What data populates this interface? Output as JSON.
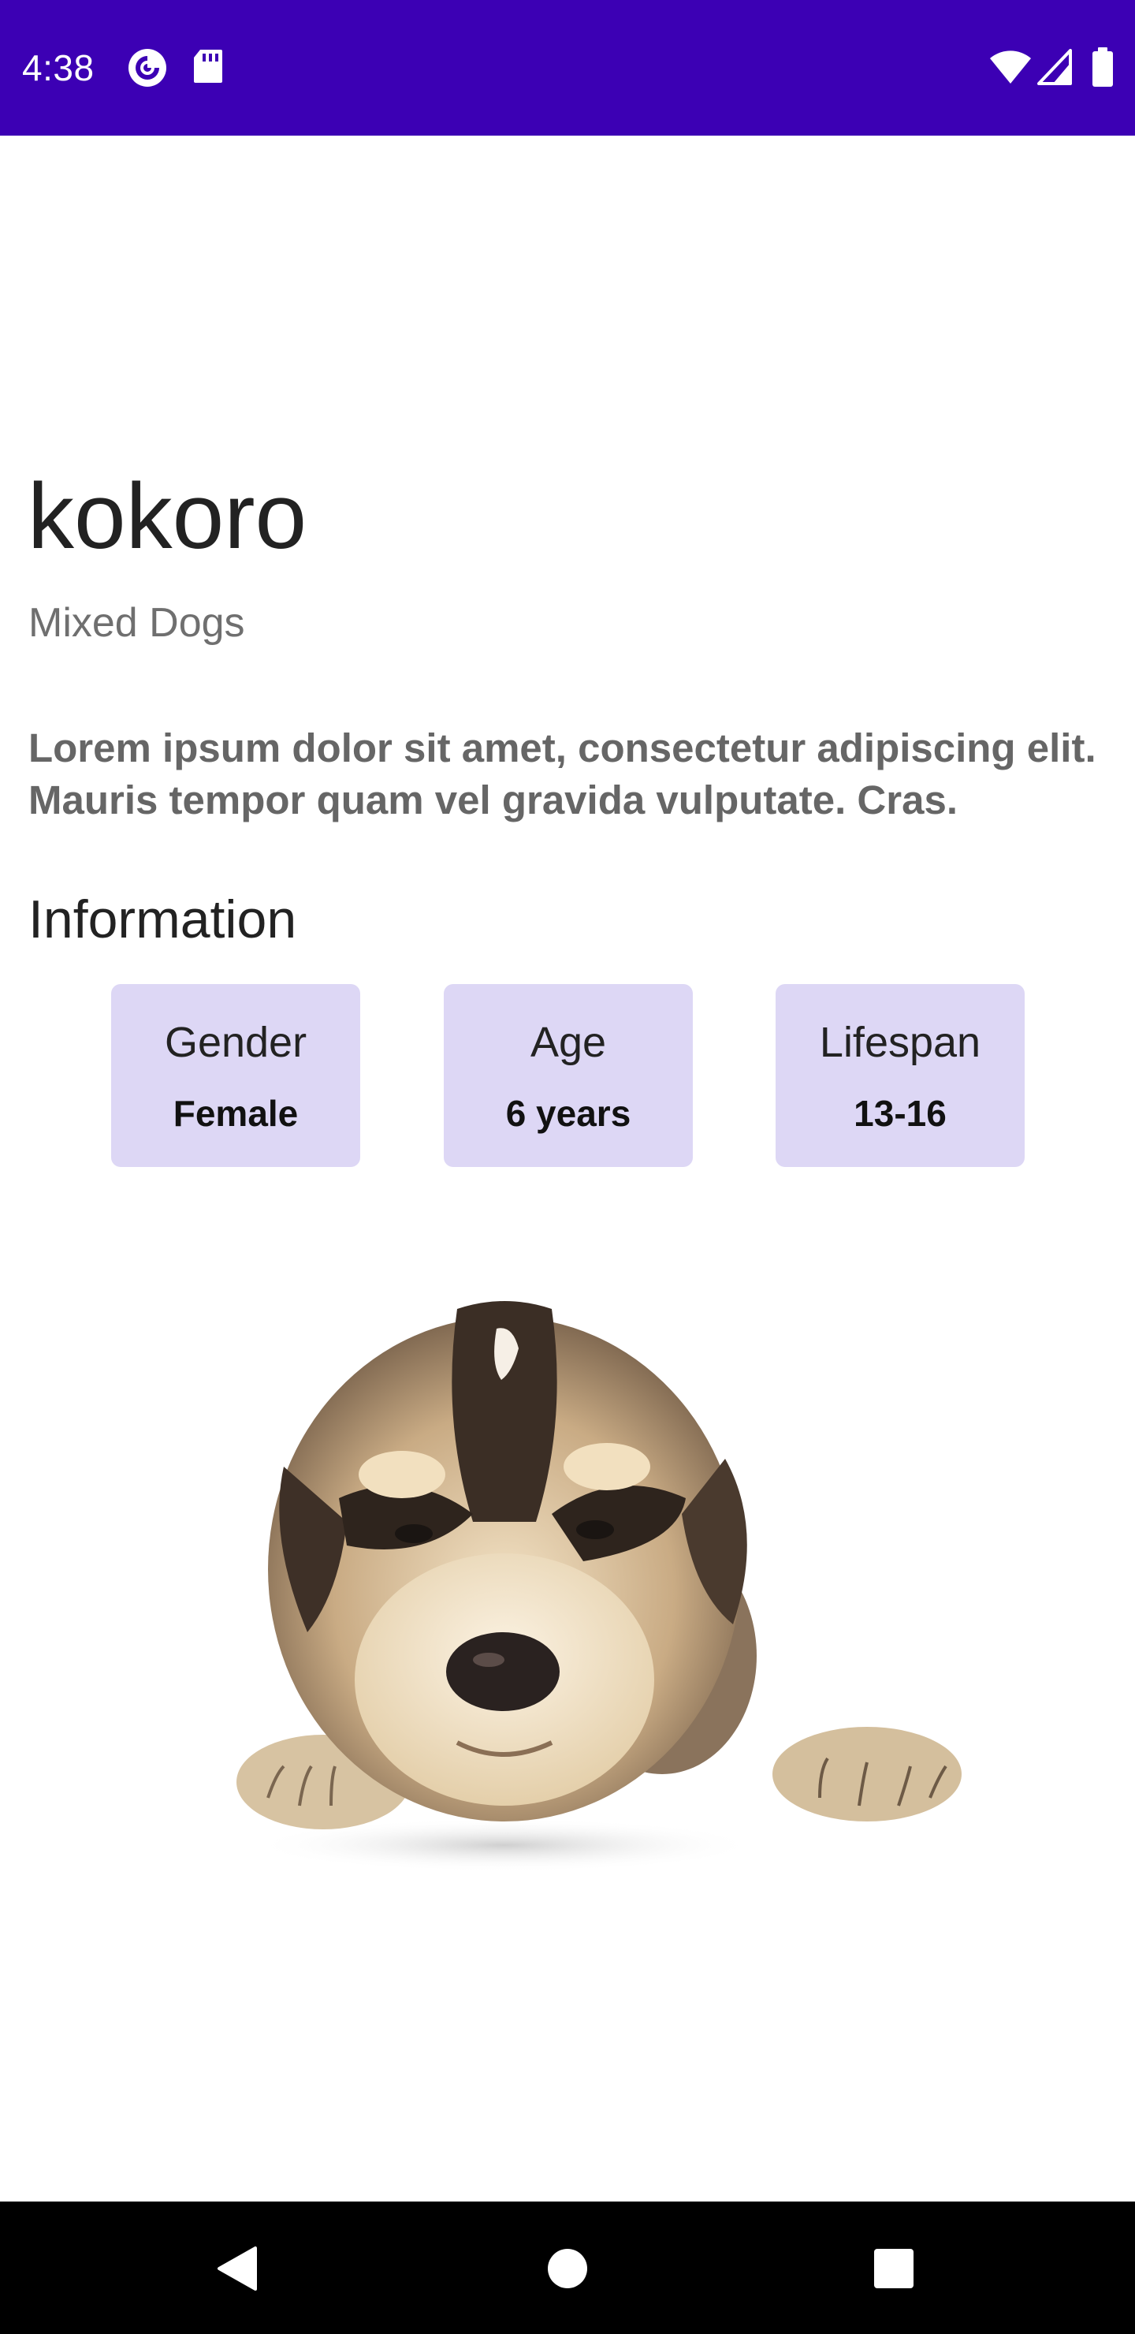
{
  "status_bar": {
    "time": "4:38",
    "background_color": "#3c00b4",
    "left_icons": [
      "pocket-casts-icon",
      "sd-card-icon"
    ],
    "right_icons": [
      "wifi-icon",
      "cellular-signal-icon",
      "battery-icon"
    ]
  },
  "pet": {
    "name": "kokoro",
    "breed": "Mixed Dogs",
    "description": "Lorem ipsum dolor sit amet, consectetur adipiscing elit. Mauris tempor quam vel gravida vulputate. Cras."
  },
  "information": {
    "heading": "Information",
    "card_color": "#ddd7f5",
    "cards": [
      {
        "label": "Gender",
        "value": "Female"
      },
      {
        "label": "Age",
        "value": "6 years"
      },
      {
        "label": "Lifespan",
        "value": "13-16"
      }
    ]
  },
  "photo": {
    "subject": "puppy-photo"
  },
  "nav_bar": {
    "buttons": [
      "back-icon",
      "home-icon",
      "recents-icon"
    ]
  }
}
